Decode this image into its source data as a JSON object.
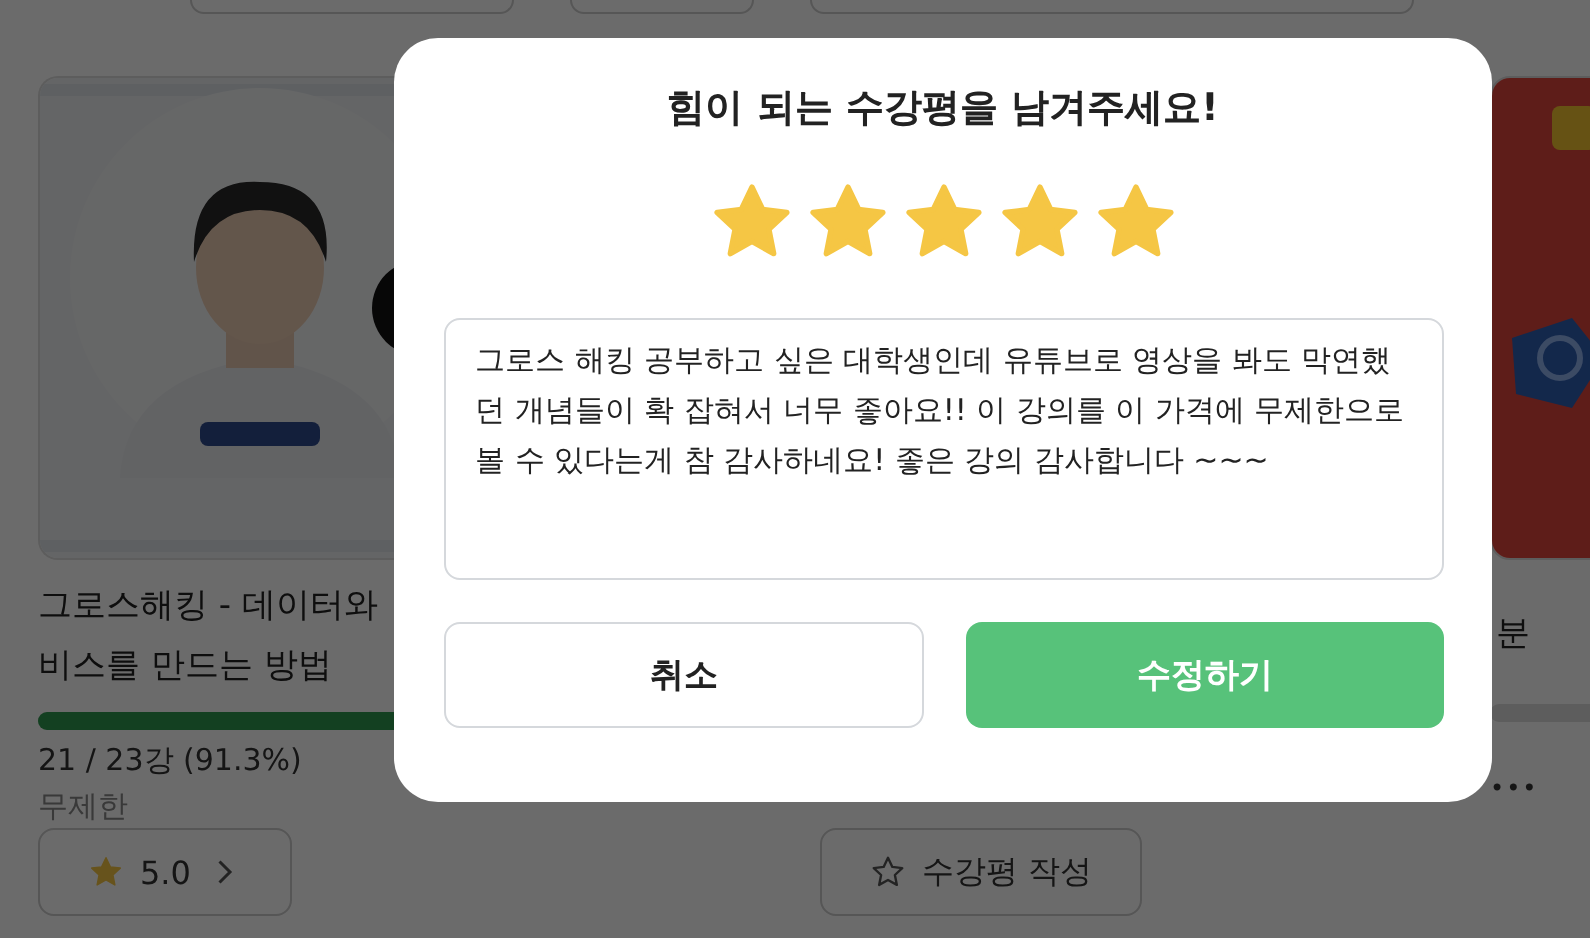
{
  "courses": [
    {
      "title_lines": [
        "그로스해킹 - 데이터와",
        "비스를 만드는 방법"
      ],
      "level": 0.913,
      "progress": "21 / 23강 (91.3%)",
      "access": "무제한",
      "action": {
        "kind": "rating",
        "label": "5.0"
      }
    },
    {
      "action": {
        "kind": "write",
        "label": "수강평 작성"
      }
    },
    {
      "title_lines": [
        "분"
      ],
      "level": 0,
      "more": "•••"
    }
  ],
  "review_dialog": {
    "title": "힘이 되는 수강평을 남겨주세요!",
    "stars": 5,
    "text": "그로스 해킹 공부하고 싶은 대학생인데 유튜브로 영상을 봐도 막연했던 개념들이 확 잡혀서 너무 좋아요!! 이 강의를 이 가격에 무제한으로 볼 수 있다는게 참 감사하네요! 좋은 강의 감사합니다 ~~~",
    "buttons": [
      {
        "kind": "cancel",
        "label": "취소"
      },
      {
        "kind": "primary",
        "label": "수정하기"
      }
    ]
  }
}
